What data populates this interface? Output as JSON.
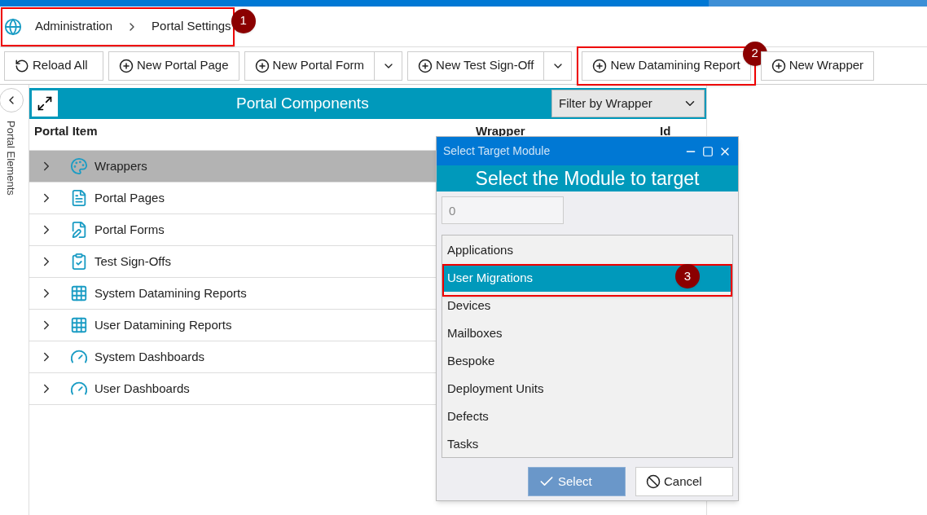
{
  "breadcrumb": {
    "items": [
      "Administration",
      "Portal Settings"
    ],
    "callout": "1"
  },
  "toolbar": [
    {
      "label": "Reload All",
      "kind": "reload"
    },
    {
      "label": "New Portal Page",
      "kind": "add"
    },
    {
      "label": "New Portal Form",
      "kind": "split"
    },
    {
      "label": "New Test Sign-Off",
      "kind": "split"
    },
    {
      "label": "New Datamining Report",
      "kind": "add",
      "callout": "2"
    },
    {
      "label": "New Wrapper",
      "kind": "add"
    }
  ],
  "side_panel": {
    "label": "Portal Elements"
  },
  "panel": {
    "title": "Portal Components",
    "filter": {
      "value": "Filter by Wrapper"
    },
    "columns": [
      "Portal Item",
      "Wrapper",
      "Id"
    ],
    "rows": [
      {
        "label": "Wrappers",
        "kind": "palette",
        "selected": true
      },
      {
        "label": "Portal Pages",
        "kind": "doc",
        "selected": false
      },
      {
        "label": "Portal Forms",
        "kind": "form",
        "selected": false
      },
      {
        "label": "Test Sign-Offs",
        "kind": "clipboard",
        "selected": false
      },
      {
        "label": "System Datamining Reports",
        "kind": "grid",
        "selected": false
      },
      {
        "label": "User Datamining Reports",
        "kind": "grid",
        "selected": false
      },
      {
        "label": "System Dashboards",
        "kind": "gauge",
        "selected": false
      },
      {
        "label": "User Dashboards",
        "kind": "gauge",
        "selected": false
      }
    ]
  },
  "dialog": {
    "title": "Select Target Module",
    "heading": "Select the Module to target",
    "input": {
      "value": "0"
    },
    "modules": [
      {
        "label": "Applications",
        "selected": false
      },
      {
        "label": "User Migrations",
        "selected": true,
        "callout": "3"
      },
      {
        "label": "Devices",
        "selected": false
      },
      {
        "label": "Mailboxes",
        "selected": false
      },
      {
        "label": "Bespoke",
        "selected": false
      },
      {
        "label": "Deployment Units",
        "selected": false
      },
      {
        "label": "Defects",
        "selected": false
      },
      {
        "label": "Tasks",
        "selected": false
      }
    ],
    "buttons": [
      {
        "label": "Select",
        "kind": "primary"
      },
      {
        "label": "Cancel",
        "kind": "cancel"
      }
    ]
  }
}
